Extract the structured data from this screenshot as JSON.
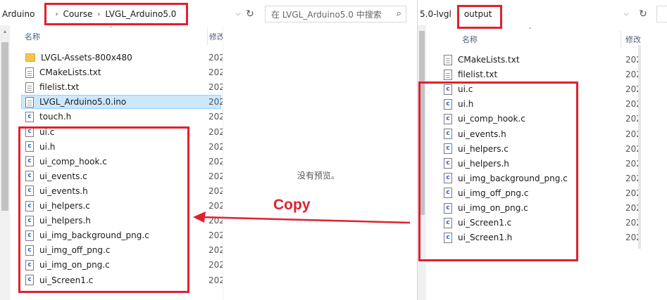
{
  "left": {
    "breadcrumb": [
      "Arduino",
      "Course",
      "LVGL_Arduino5.0"
    ],
    "search_placeholder": "在 LVGL_Arduino5.0 中搜索",
    "col_name": "名称",
    "col_date": "修改",
    "preview_text": "没有预览。",
    "files": [
      {
        "name": "LVGL-Assets-800x480",
        "icon": "folder-icon",
        "date": "202"
      },
      {
        "name": "CMakeLists.txt",
        "icon": "text-file-icon",
        "date": "202"
      },
      {
        "name": "filelist.txt",
        "icon": "text-file-icon",
        "date": "202"
      },
      {
        "name": "LVGL_Arduino5.0.ino",
        "icon": "text-file-icon",
        "date": "202",
        "selected": true
      },
      {
        "name": "touch.h",
        "icon": "c-file-icon",
        "date": "202"
      },
      {
        "name": "ui.c",
        "icon": "c-file-icon",
        "date": "202"
      },
      {
        "name": "ui.h",
        "icon": "c-file-icon",
        "date": "202"
      },
      {
        "name": "ui_comp_hook.c",
        "icon": "c-file-icon",
        "date": "202"
      },
      {
        "name": "ui_events.c",
        "icon": "c-file-icon",
        "date": "202"
      },
      {
        "name": "ui_events.h",
        "icon": "c-file-icon",
        "date": "202"
      },
      {
        "name": "ui_helpers.c",
        "icon": "c-file-icon",
        "date": "202"
      },
      {
        "name": "ui_helpers.h",
        "icon": "c-file-icon",
        "date": "202"
      },
      {
        "name": "ui_img_background_png.c",
        "icon": "c-file-icon",
        "date": "202"
      },
      {
        "name": "ui_img_off_png.c",
        "icon": "c-file-icon",
        "date": "202"
      },
      {
        "name": "ui_img_on_png.c",
        "icon": "c-file-icon",
        "date": "202"
      },
      {
        "name": "ui_Screen1.c",
        "icon": "c-file-icon",
        "date": "202"
      }
    ]
  },
  "right": {
    "breadcrumb": [
      "5.0-lvgl",
      "output"
    ],
    "col_name": "名称",
    "col_date": "修改",
    "files": [
      {
        "name": "CMakeLists.txt",
        "icon": "text-file-icon",
        "date": "202"
      },
      {
        "name": "filelist.txt",
        "icon": "text-file-icon",
        "date": "202"
      },
      {
        "name": "ui.c",
        "icon": "c-file-icon",
        "date": "202"
      },
      {
        "name": "ui.h",
        "icon": "c-file-icon",
        "date": "202"
      },
      {
        "name": "ui_comp_hook.c",
        "icon": "c-file-icon",
        "date": "202"
      },
      {
        "name": "ui_events.h",
        "icon": "c-file-icon",
        "date": "202"
      },
      {
        "name": "ui_helpers.c",
        "icon": "c-file-icon",
        "date": "202"
      },
      {
        "name": "ui_helpers.h",
        "icon": "c-file-icon",
        "date": "202"
      },
      {
        "name": "ui_img_background_png.c",
        "icon": "c-file-icon",
        "date": "202"
      },
      {
        "name": "ui_img_off_png.c",
        "icon": "c-file-icon",
        "date": "202"
      },
      {
        "name": "ui_img_on_png.c",
        "icon": "c-file-icon",
        "date": "202"
      },
      {
        "name": "ui_Screen1.c",
        "icon": "c-file-icon",
        "date": "202"
      },
      {
        "name": "ui_Screen1.h",
        "icon": "c-file-icon",
        "date": "202"
      }
    ]
  },
  "annotation": {
    "copy_label": "Copy",
    "color": "#e02030"
  }
}
